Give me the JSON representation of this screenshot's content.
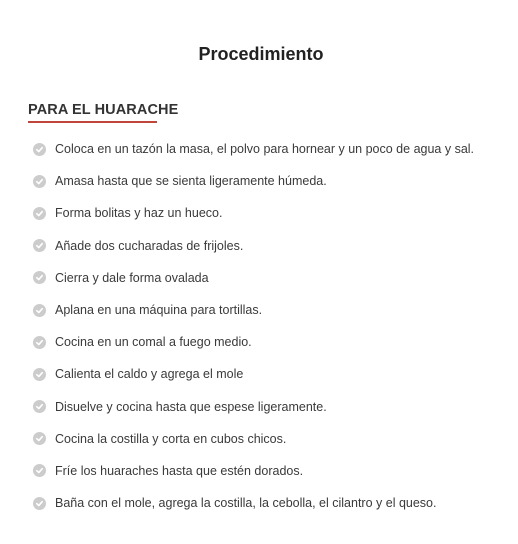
{
  "title": "Procedimiento",
  "section": {
    "heading": "PARA EL HUARACHE",
    "accent_color": "#c0463b"
  },
  "check_icon": "check-circle-icon",
  "steps": [
    "Coloca en un tazón la masa, el polvo para hornear y un poco de agua y sal.",
    "Amasa hasta que se sienta ligeramente húmeda.",
    "Forma bolitas y haz un hueco.",
    "Añade dos cucharadas de frijoles.",
    "Cierra y dale forma ovalada",
    "Aplana en una máquina para tortillas.",
    "Cocina en un comal a fuego medio.",
    "Calienta el caldo y agrega el mole",
    "Disuelve y cocina hasta que espese ligeramente.",
    "Cocina la costilla y corta en cubos chicos.",
    "Fríe los huaraches hasta que estén dorados.",
    "Baña con el mole, agrega la costilla, la cebolla, el cilantro y el queso."
  ]
}
